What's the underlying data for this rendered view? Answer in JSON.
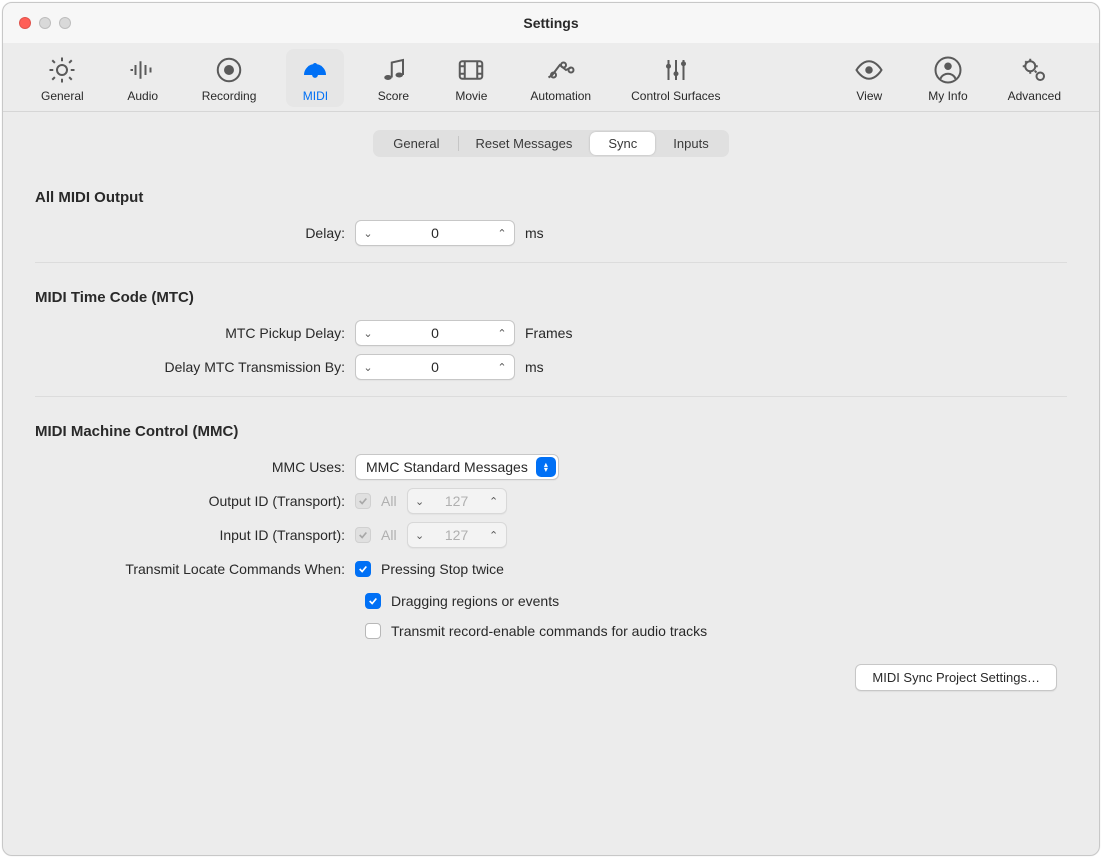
{
  "window": {
    "title": "Settings"
  },
  "toolbar": {
    "tabs": [
      {
        "id": "general",
        "label": "General",
        "icon": "gear"
      },
      {
        "id": "audio",
        "label": "Audio",
        "icon": "waveform"
      },
      {
        "id": "recording",
        "label": "Recording",
        "icon": "record"
      },
      {
        "id": "midi",
        "label": "MIDI",
        "icon": "gauge",
        "active": true
      },
      {
        "id": "score",
        "label": "Score",
        "icon": "notes"
      },
      {
        "id": "movie",
        "label": "Movie",
        "icon": "film"
      },
      {
        "id": "automation",
        "label": "Automation",
        "icon": "automation"
      },
      {
        "id": "control",
        "label": "Control Surfaces",
        "icon": "sliders"
      },
      {
        "id": "view",
        "label": "View",
        "icon": "eye"
      },
      {
        "id": "myinfo",
        "label": "My Info",
        "icon": "person"
      },
      {
        "id": "advanced",
        "label": "Advanced",
        "icon": "gears"
      }
    ]
  },
  "segmented": {
    "tabs": [
      "General",
      "Reset Messages",
      "Sync",
      "Inputs"
    ],
    "selected": "Sync"
  },
  "sections": {
    "allmidi": {
      "title": "All MIDI Output",
      "delay_label": "Delay:",
      "delay_value": "0",
      "delay_unit": "ms"
    },
    "mtc": {
      "title": "MIDI Time Code (MTC)",
      "pickup_label": "MTC Pickup Delay:",
      "pickup_value": "0",
      "pickup_unit": "Frames",
      "trans_label": "Delay MTC Transmission By:",
      "trans_value": "0",
      "trans_unit": "ms"
    },
    "mmc": {
      "title": "MIDI Machine Control (MMC)",
      "uses_label": "MMC Uses:",
      "uses_value": "MMC Standard Messages",
      "output_label": "Output ID (Transport):",
      "output_all_label": "All",
      "output_all_checked": true,
      "output_value": "127",
      "input_label": "Input ID (Transport):",
      "input_all_label": "All",
      "input_all_checked": true,
      "input_value": "127",
      "transmit_label": "Transmit Locate Commands When:",
      "cb1_label": "Pressing Stop twice",
      "cb1_checked": true,
      "cb2_label": "Dragging regions or events",
      "cb2_checked": true,
      "cb3_label": "Transmit record-enable commands for audio tracks",
      "cb3_checked": false
    }
  },
  "footer": {
    "button": "MIDI Sync Project Settings…"
  }
}
